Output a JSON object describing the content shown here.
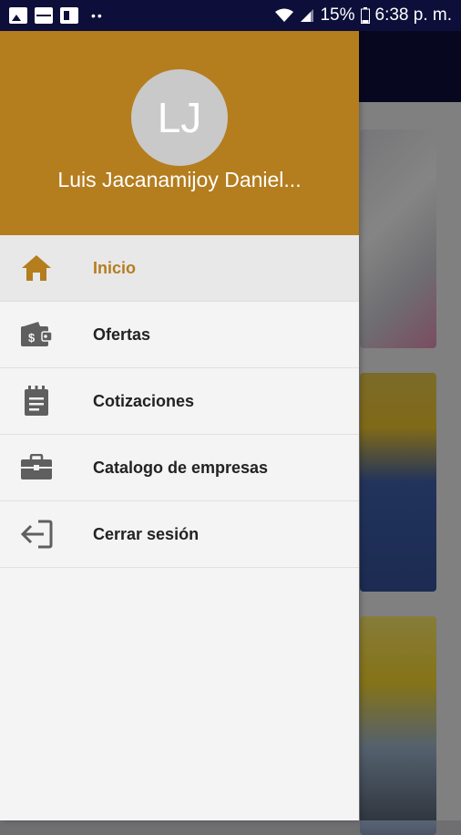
{
  "status_bar": {
    "battery": "15%",
    "time": "6:38 p. m."
  },
  "drawer": {
    "avatar_initials": "LJ",
    "user_name": "Luis Jacanamijoy Daniel...",
    "menu": [
      {
        "label": "Inicio",
        "icon": "home-icon",
        "active": true
      },
      {
        "label": "Ofertas",
        "icon": "wallet-icon",
        "active": false
      },
      {
        "label": "Cotizaciones",
        "icon": "clipboard-icon",
        "active": false
      },
      {
        "label": "Catalogo de empresas",
        "icon": "briefcase-icon",
        "active": false
      },
      {
        "label": "Cerrar sesión",
        "icon": "logout-icon",
        "active": false
      }
    ]
  },
  "colors": {
    "accent": "#b47d1e",
    "status_bar": "#0d0f3a",
    "icon_gray": "#5f5f5f"
  }
}
